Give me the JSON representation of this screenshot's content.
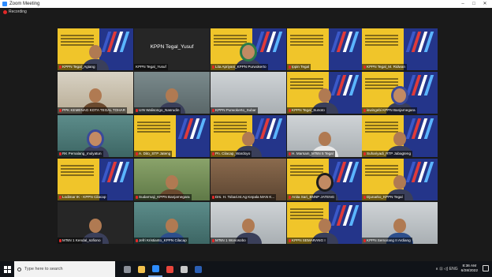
{
  "window": {
    "title": "Zoom Meeting",
    "controls": [
      "–",
      "□",
      "✕"
    ]
  },
  "recording": {
    "label": "Recording"
  },
  "participants": [
    {
      "name": "KPPN Tegal_Agiang",
      "bg": "banner",
      "person": "plain",
      "muted": true,
      "active": true
    },
    {
      "name": "KPPN Tegal_Yusuf",
      "bg": "dark",
      "person": "none",
      "muted": false,
      "center": "KPPN Tegal_Yusuf"
    },
    {
      "name": "Lita Apriyani_KPPN Purwokerto",
      "bg": "banner",
      "person": "hijab",
      "muted": true
    },
    {
      "name": "Ippin Tegal",
      "bg": "banner",
      "person": "none",
      "muted": true
    },
    {
      "name": "KPPN Tegal_M. Ridwan",
      "bg": "banner",
      "person": "none",
      "muted": true
    },
    {
      "name": "PPK KEMENAG KOTA TEGAL TOHAR",
      "bg": "office",
      "person": "batik",
      "muted": true
    },
    {
      "name": "UIN Walisongo_Nasrudin",
      "bg": "room",
      "person": "plain",
      "muted": true
    },
    {
      "name": "KPPN Purwokerto_Subar",
      "bg": "wall",
      "person": "none",
      "muted": true
    },
    {
      "name": "KPPN Tegal_Sunoto",
      "bg": "banner",
      "person": "plain",
      "muted": true
    },
    {
      "name": "iswingebi KPPN Banjarnegara",
      "bg": "banner",
      "person": "hijab2",
      "muted": true
    },
    {
      "name": "RK Pemalang_mulyatun",
      "bg": "teal",
      "person": "hijab2",
      "muted": true
    },
    {
      "name": "A. Dito_STP Jateng",
      "bg": "banner",
      "person": "none",
      "muted": true
    },
    {
      "name": "Pn. Cilacap_Wardoyo",
      "bg": "banner",
      "person": "plain",
      "muted": true
    },
    {
      "name": "H. Marsam_MTsN 5 Tegal",
      "bg": "wall",
      "person": "white",
      "muted": true
    },
    {
      "name": "Suhariyadi_RTP Jabagteng",
      "bg": "banner",
      "person": "plain",
      "muted": true
    },
    {
      "name": "Lodimar IK - KPPN Cilacap",
      "bg": "banner",
      "person": "none",
      "muted": true
    },
    {
      "name": "Sudarmaji_KPPN Banjarnegara",
      "bg": "green",
      "person": "batik",
      "muted": true
    },
    {
      "name": "Drs. H. Tobari.M.Ag Kepala MAN K...",
      "bg": "brown",
      "person": "none",
      "muted": true
    },
    {
      "name": "Anita Sari_BNNP JATENG",
      "bg": "banner",
      "person": "hijab3",
      "muted": true
    },
    {
      "name": "Djunarko_KPPN Tegal",
      "bg": "banner",
      "person": "plain",
      "muted": true
    },
    {
      "name": "MTsN 1 Kendal_sofiono",
      "bg": "dark",
      "person": "plain",
      "muted": true
    },
    {
      "name": "Jefri Kristianto_KPPN Cilacap",
      "bg": "teal",
      "person": "blue",
      "muted": true
    },
    {
      "name": "MTsN 1 Wonosobo",
      "bg": "wall",
      "person": "plain",
      "muted": true
    },
    {
      "name": "KPPN SEMARANG I",
      "bg": "banner",
      "person": "plain",
      "muted": true
    },
    {
      "name": "KPPN Semarang II Ardiang",
      "bg": "wall",
      "person": "blue",
      "muted": true
    }
  ],
  "taskbar": {
    "search_placeholder": "Type here to search",
    "apps": [
      {
        "icon": "task-view-icon",
        "color": "#8a8f99"
      },
      {
        "icon": "file-explorer-icon",
        "color": "#f2c14e"
      },
      {
        "icon": "zoom-icon",
        "color": "#2d8cff",
        "open": true
      },
      {
        "icon": "chrome-icon",
        "color": "#e8453c"
      },
      {
        "icon": "shield-icon",
        "color": "#c9c9c9"
      },
      {
        "icon": "word-icon",
        "color": "#2b5fb4"
      }
    ],
    "tray_glyphs": "∧ ⊡ ◁) ENG",
    "time": "8:36 AM",
    "date": "6/28/2022"
  }
}
